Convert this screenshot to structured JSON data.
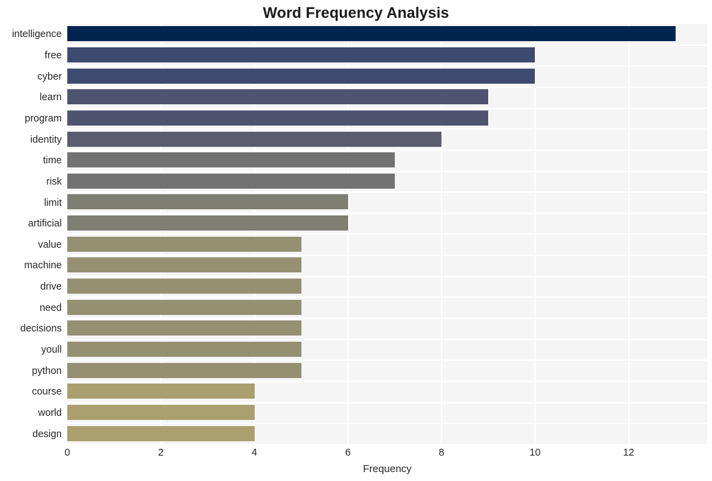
{
  "chart_data": {
    "type": "bar",
    "orientation": "horizontal",
    "title": "Word Frequency Analysis",
    "xlabel": "Frequency",
    "ylabel": "",
    "categories": [
      "intelligence",
      "free",
      "cyber",
      "learn",
      "program",
      "identity",
      "time",
      "risk",
      "limit",
      "artificial",
      "value",
      "machine",
      "drive",
      "need",
      "decisions",
      "youll",
      "python",
      "course",
      "world",
      "design"
    ],
    "values": [
      13,
      10,
      10,
      9,
      9,
      8,
      7,
      7,
      6,
      6,
      5,
      5,
      5,
      5,
      5,
      5,
      5,
      4,
      4,
      4
    ],
    "bar_colors": [
      "#02244f",
      "#3e4b70",
      "#3e4b70",
      "#4e5470",
      "#4e5470",
      "#5b5d6e",
      "#727272",
      "#727272",
      "#7f7e72",
      "#7f7e72",
      "#969073",
      "#969073",
      "#969073",
      "#969073",
      "#969073",
      "#969073",
      "#969073",
      "#aa9f6e",
      "#aa9f6e",
      "#aa9f6e"
    ],
    "xlim": [
      0,
      13.68
    ],
    "xticks": [
      0,
      2,
      4,
      6,
      8,
      10,
      12
    ],
    "xticklabels": [
      "0",
      "2",
      "4",
      "6",
      "8",
      "10",
      "12"
    ],
    "grid": true,
    "grid_color": "#ffffff",
    "plot_background": "#f5f5f6",
    "figure_background": "#ffffff",
    "legend": null
  }
}
